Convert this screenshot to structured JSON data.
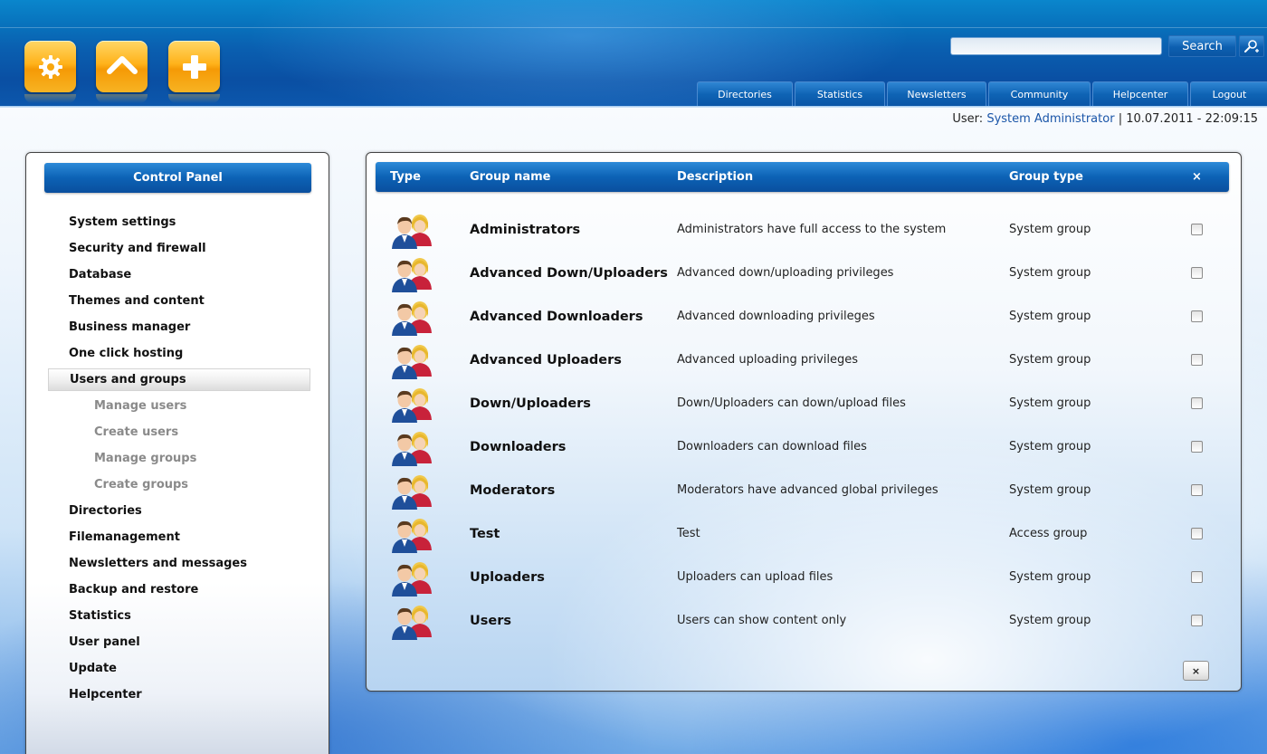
{
  "toolbar": {
    "icons": [
      "gear-icon",
      "home-icon",
      "add-icon"
    ]
  },
  "search": {
    "placeholder": "",
    "button_label": "Search",
    "advanced_icon": "advanced-search-icon"
  },
  "topnav": {
    "tabs": [
      {
        "label": "Directories"
      },
      {
        "label": "Statistics"
      },
      {
        "label": "Newsletters"
      },
      {
        "label": "Community"
      },
      {
        "label": "Helpcenter"
      },
      {
        "label": "Logout"
      }
    ]
  },
  "userbar": {
    "prefix": "User:",
    "user_name": "System Administrator",
    "separator": "|",
    "datetime": "10.07.2011 - 22:09:15"
  },
  "sidebar": {
    "title": "Control Panel",
    "items": [
      {
        "label": "System settings"
      },
      {
        "label": "Security and firewall"
      },
      {
        "label": "Database"
      },
      {
        "label": "Themes and content"
      },
      {
        "label": "Business manager"
      },
      {
        "label": "One click hosting"
      },
      {
        "label": "Users and groups",
        "active": true
      },
      {
        "label": "Manage users",
        "sub": true
      },
      {
        "label": "Create users",
        "sub": true
      },
      {
        "label": "Manage groups",
        "sub": true
      },
      {
        "label": "Create groups",
        "sub": true
      },
      {
        "label": "Directories"
      },
      {
        "label": "Filemanagement"
      },
      {
        "label": "Newsletters and messages"
      },
      {
        "label": "Backup and restore"
      },
      {
        "label": "Statistics"
      },
      {
        "label": "User panel"
      },
      {
        "label": "Update"
      },
      {
        "label": "Helpcenter"
      }
    ]
  },
  "groups_table": {
    "columns": {
      "type": "Type",
      "name": "Group name",
      "description": "Description",
      "group_type": "Group type",
      "select": "×"
    },
    "rows": [
      {
        "name": "Administrators",
        "description": "Administrators have full access to the system",
        "group_type": "System group",
        "checked": false
      },
      {
        "name": "Advanced Down/Uploaders",
        "description": "Advanced down/uploading privileges",
        "group_type": "System group",
        "checked": false
      },
      {
        "name": "Advanced Downloaders",
        "description": "Advanced downloading privileges",
        "group_type": "System group",
        "checked": false
      },
      {
        "name": "Advanced Uploaders",
        "description": "Advanced uploading privileges",
        "group_type": "System group",
        "checked": false
      },
      {
        "name": "Down/Uploaders",
        "description": "Down/Uploaders can down/upload files",
        "group_type": "System group",
        "checked": false
      },
      {
        "name": "Downloaders",
        "description": "Downloaders can download files",
        "group_type": "System group",
        "checked": false
      },
      {
        "name": "Moderators",
        "description": "Moderators have advanced global privileges",
        "group_type": "System group",
        "checked": false
      },
      {
        "name": "Test",
        "description": "Test",
        "group_type": "Access group",
        "checked": false
      },
      {
        "name": "Uploaders",
        "description": "Uploaders can upload files",
        "group_type": "System group",
        "checked": false
      },
      {
        "name": "Users",
        "description": "Users can show content only",
        "group_type": "System group",
        "checked": false
      }
    ],
    "row_icon": "user-group-icon",
    "delete_label": "×"
  },
  "colors": {
    "accent": "#0c62b5",
    "icon_orange": "#ffb21a",
    "link": "#1a55a8"
  }
}
